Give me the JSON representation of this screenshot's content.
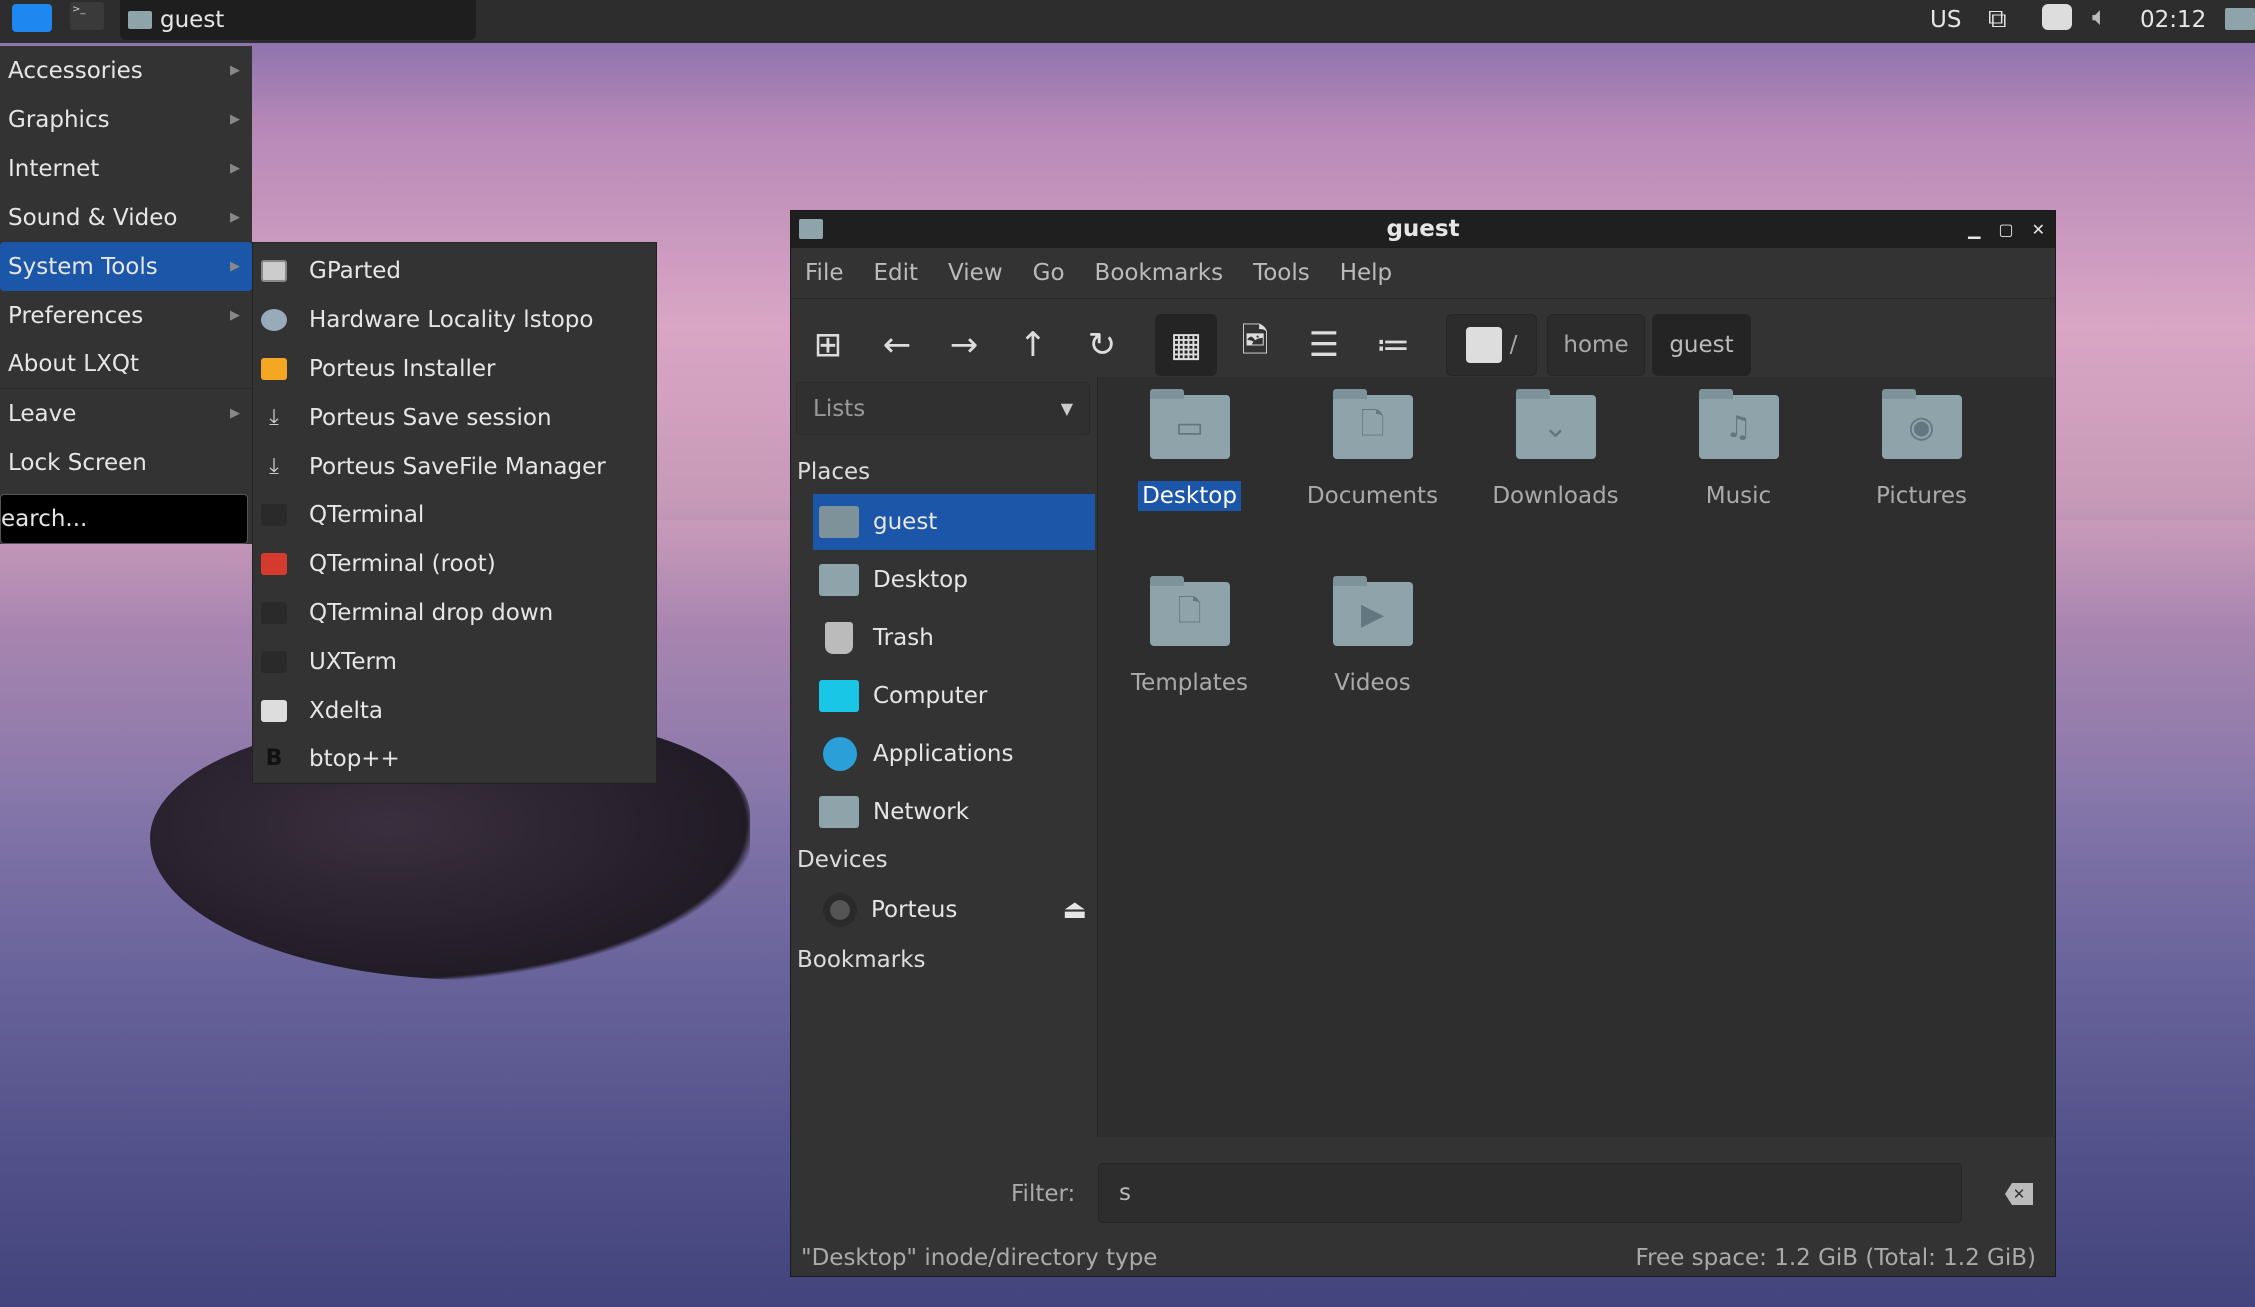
{
  "taskbar": {
    "task_title": "guest",
    "tray": {
      "keyboard_layout": "US",
      "clock": "02:12"
    }
  },
  "main_menu": {
    "items": [
      {
        "label": "Accessories",
        "submenu": true
      },
      {
        "label": "Graphics",
        "submenu": true
      },
      {
        "label": "Internet",
        "submenu": true
      },
      {
        "label": "Sound & Video",
        "submenu": true
      },
      {
        "label": "System Tools",
        "submenu": true,
        "selected": true
      },
      {
        "label": "Preferences",
        "submenu": true
      },
      {
        "label": "About LXQt",
        "submenu": false
      },
      {
        "label": "Leave",
        "submenu": true
      },
      {
        "label": "Lock Screen",
        "submenu": false
      }
    ],
    "search_text": "earch..."
  },
  "submenu": {
    "items": [
      {
        "label": "GParted",
        "icon": "gparted-icon"
      },
      {
        "label": "Hardware Locality lstopo",
        "icon": "gear-icon"
      },
      {
        "label": "Porteus Installer",
        "icon": "installer-icon"
      },
      {
        "label": "Porteus Save session",
        "icon": "download-icon"
      },
      {
        "label": "Porteus SaveFile Manager",
        "icon": "download-icon"
      },
      {
        "label": "QTerminal",
        "icon": "terminal-icon"
      },
      {
        "label": "QTerminal (root)",
        "icon": "terminal-root-icon"
      },
      {
        "label": "QTerminal drop down",
        "icon": "terminal-icon"
      },
      {
        "label": "UXTerm",
        "icon": "terminal-icon"
      },
      {
        "label": "Xdelta",
        "icon": "xdelta-icon"
      },
      {
        "label": "btop++",
        "icon": "btop-icon"
      }
    ]
  },
  "window": {
    "title": "guest",
    "menubar": [
      "File",
      "Edit",
      "View",
      "Go",
      "Bookmarks",
      "Tools",
      "Help"
    ],
    "breadcrumb": {
      "root": "/",
      "items": [
        "home",
        "guest"
      ]
    },
    "side_pane_mode": "Lists",
    "places_label": "Places",
    "places": [
      {
        "label": "guest",
        "selected": true
      },
      {
        "label": "Desktop"
      },
      {
        "label": "Trash"
      },
      {
        "label": "Computer"
      },
      {
        "label": "Applications"
      },
      {
        "label": "Network"
      }
    ],
    "devices_label": "Devices",
    "devices": [
      {
        "label": "Porteus"
      }
    ],
    "bookmarks_label": "Bookmarks",
    "files": [
      {
        "name": "Desktop",
        "glyph": "▭",
        "selected": true
      },
      {
        "name": "Documents",
        "glyph": "🗋"
      },
      {
        "name": "Downloads",
        "glyph": "⌄"
      },
      {
        "name": "Music",
        "glyph": "♫"
      },
      {
        "name": "Pictures",
        "glyph": "◉"
      },
      {
        "name": "Templates",
        "glyph": "🗋"
      },
      {
        "name": "Videos",
        "glyph": "▶"
      }
    ],
    "filter_label": "Filter:",
    "filter_value": "s",
    "status_left": "\"Desktop\" inode/directory type",
    "status_right": "Free space: 1.2 GiB (Total: 1.2 GiB)"
  },
  "colors": {
    "accent": "#1b56a8",
    "panel": "#333333"
  }
}
